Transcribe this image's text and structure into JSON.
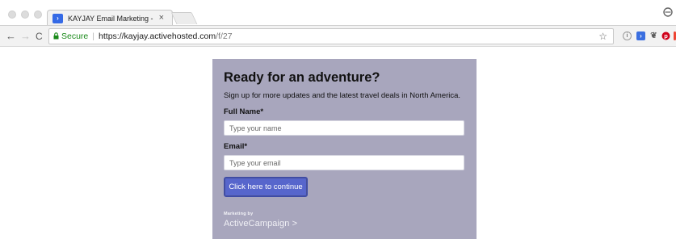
{
  "browser": {
    "tab": {
      "title": "KAYJAY Email Marketing -",
      "close_glyph": "×",
      "favicon_glyph": "›"
    },
    "nav": {
      "back_glyph": "←",
      "forward_glyph": "→",
      "reload_glyph": "C"
    },
    "address_bar": {
      "secure_label": "Secure",
      "separator": "|",
      "url_host": "https://kayjay.activehosted.com",
      "url_path": "/f/27"
    },
    "icons": [
      "star-icon",
      "info-icon",
      "activecampaign-extension-icon",
      "evernote-icon",
      "pinterest-icon",
      "red-extension-icon",
      "profile-icon"
    ]
  },
  "form": {
    "title": "Ready for an adventure?",
    "subtitle": "Sign up for more updates and the latest travel deals in North America.",
    "full_name": {
      "label": "Full Name*",
      "placeholder": "Type your name",
      "value": ""
    },
    "email": {
      "label": "Email*",
      "placeholder": "Type your email",
      "value": ""
    },
    "submit_label": "Click here to continue",
    "marketing_by": "Marketing by",
    "brand": "ActiveCampaign >"
  },
  "colors": {
    "card_background": "#a8a6bd",
    "button_background": "#5766cc",
    "secure_green": "#1a8a1a"
  }
}
